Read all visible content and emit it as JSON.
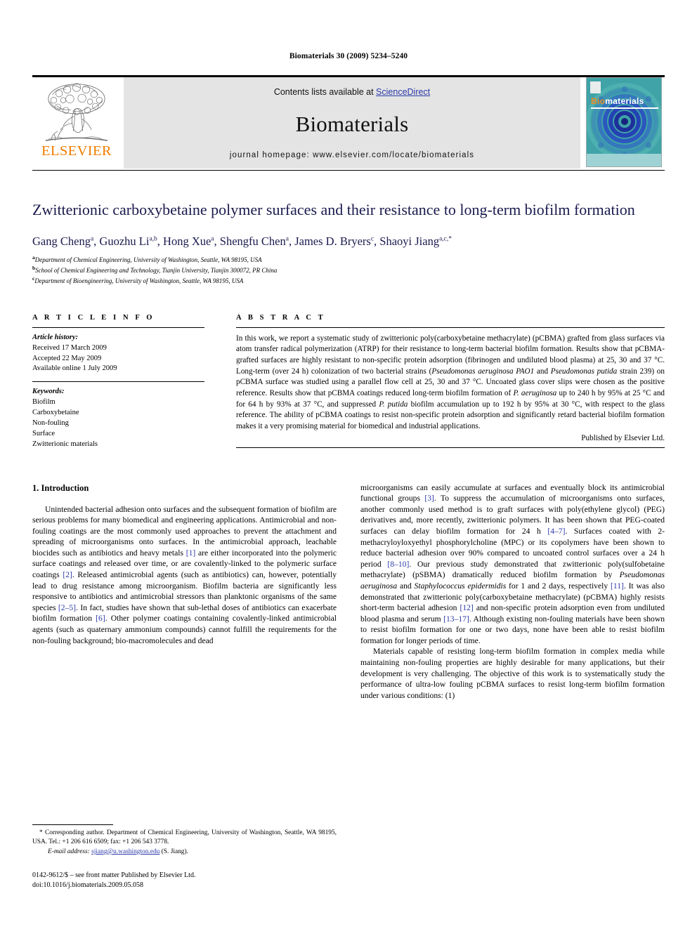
{
  "running_head": "Biomaterials 30 (2009) 5234–5240",
  "journal_header": {
    "publisher_logo_label": "ELSEVIER",
    "contents_prefix": "Contents lists available at ",
    "contents_link": "ScienceDirect",
    "journal_title": "Biomaterials",
    "homepage": "journal homepage: www.elsevier.com/locate/biomaterials",
    "cover": {
      "title_part1": "Bio",
      "title_part2": "materials"
    },
    "link_color": "#2b39a8",
    "band_color": "#e4e4e4",
    "elsevier_orange": "#F07D00"
  },
  "article": {
    "title": "Zwitterionic carboxybetaine polymer surfaces and their resistance to long-term biofilm formation",
    "authors": [
      {
        "name": "Gang Cheng",
        "sup": "a"
      },
      {
        "name": "Guozhu Li",
        "sup": "a,b"
      },
      {
        "name": "Hong Xue",
        "sup": "a"
      },
      {
        "name": "Shengfu Chen",
        "sup": "a"
      },
      {
        "name": "James D. Bryers",
        "sup": "c"
      },
      {
        "name": "Shaoyi Jiang",
        "sup": "a,c,*"
      }
    ],
    "affiliations": [
      {
        "mark": "a",
        "text": "Department of Chemical Engineering, University of Washington, Seattle, WA 98195, USA"
      },
      {
        "mark": "b",
        "text": "School of Chemical Engineering and Technology, Tianjin University, Tianjin 300072, PR China"
      },
      {
        "mark": "c",
        "text": "Department of Bioengineering, University of Washington, Seattle, WA 98195, USA"
      }
    ],
    "title_color": "#1a1a4e"
  },
  "article_info": {
    "heading": "A R T I C L E   I N F O",
    "history_label": "Article history:",
    "history": [
      "Received 17 March 2009",
      "Accepted 22 May 2009",
      "Available online 1 July 2009"
    ],
    "keywords_label": "Keywords:",
    "keywords": [
      "Biofilm",
      "Carboxybetaine",
      "Non-fouling",
      "Surface",
      "Zwitterionic materials"
    ]
  },
  "abstract": {
    "heading": "A B S T R A C T",
    "paragraphs": [
      "In this work, we report a systematic study of zwitterionic poly(carboxybetaine methacrylate) (pCBMA) grafted from glass surfaces via atom transfer radical polymerization (ATRP) for their resistance to long-term bacterial biofilm formation. Results show that pCBMA-grafted surfaces are highly resistant to non-specific protein adsorption (fibrinogen and undiluted blood plasma) at 25, 30 and 37 °C. Long-term (over 24 h) colonization of two bacterial strains (Pseudomonas aeruginosa PAO1 and Pseudomonas putida strain 239) on pCBMA surface was studied using a parallel flow cell at 25, 30 and 37 °C. Uncoated glass cover slips were chosen as the positive reference. Results show that pCBMA coatings reduced long-term biofilm formation of P. aeruginosa up to 240 h by 95% at 25 °C and for 64 h by 93% at 37 °C, and suppressed P. putida biofilm accumulation up to 192 h by 95% at 30 °C, with respect to the glass reference. The ability of pCBMA coatings to resist non-specific protein adsorption and significantly retard bacterial biofilm formation makes it a very promising material for biomedical and industrial applications."
    ],
    "published_by": "Published by Elsevier Ltd."
  },
  "introduction": {
    "heading": "1. Introduction",
    "left_paragraphs": [
      "Unintended bacterial adhesion onto surfaces and the subsequent formation of biofilm are serious problems for many biomedical and engineering applications. Antimicrobial and non-fouling coatings are the most commonly used approaches to prevent the attachment and spreading of microorganisms onto surfaces. In the antimicrobial approach, leachable biocides such as antibiotics and heavy metals [1] are either incorporated into the polymeric surface coatings and released over time, or are covalently-linked to the polymeric surface coatings [2]. Released antimicrobial agents (such as antibiotics) can, however, potentially lead to drug resistance among microorganism. Biofilm bacteria are significantly less responsive to antibiotics and antimicrobial stressors than planktonic organisms of the same species [2–5]. In fact, studies have shown that sub-lethal doses of antibiotics can exacerbate biofilm formation [6]. Other polymer coatings containing covalently-linked antimicrobial agents (such as quaternary ammonium compounds) cannot fulfill the requirements for the non-fouling background; bio-macromolecules and dead"
    ],
    "right_paragraphs": [
      "microorganisms can easily accumulate at surfaces and eventually block its antimicrobial functional groups [3]. To suppress the accumulation of microorganisms onto surfaces, another commonly used method is to graft surfaces with poly(ethylene glycol) (PEG) derivatives and, more recently, zwitterionic polymers. It has been shown that PEG-coated surfaces can delay biofilm formation for 24 h [4–7]. Surfaces coated with 2-methacryloyloxyethyl phosphorylcholine (MPC) or its copolymers have been shown to reduce bacterial adhesion over 90% compared to uncoated control surfaces over a 24 h period [8–10]. Our previous study demonstrated that zwitterionic poly(sulfobetaine methacrylate) (pSBMA) dramatically reduced biofilm formation by Pseudomonas aeruginosa and Staphylococcus epidermidis for 1 and 2 days, respectively [11]. It was also demonstrated that zwitterionic poly(carboxybetaine methacrylate) (pCBMA) highly resists short-term bacterial adhesion [12] and non-specific protein adsorption even from undiluted blood plasma and serum [13–17]. Although existing non-fouling materials have been shown to resist biofilm formation for one or two days, none have been able to resist biofilm formation for longer periods of time.",
      "Materials capable of resisting long-term biofilm formation in complex media while maintaining non-fouling properties are highly desirable for many applications, but their development is very challenging. The objective of this work is to systematically study the performance of ultra-low fouling pCBMA surfaces to resist long-term biofilm formation under various conditions: (1)"
    ],
    "ref_color": "#2b39a8"
  },
  "footnotes": {
    "corresponding": "* Corresponding author. Department of Chemical Engineering, University of Washington, Seattle, WA 98195, USA. Tel.: +1 206 616 6509; fax: +1 206 543 3778.",
    "email_label": "E-mail address:",
    "email": "sjiang@u.washington.edu",
    "email_suffix": "(S. Jiang).",
    "issn_line": "0142-9612/$ – see front matter Published by Elsevier Ltd.",
    "doi_line": "doi:10.1016/j.biomaterials.2009.05.058"
  }
}
